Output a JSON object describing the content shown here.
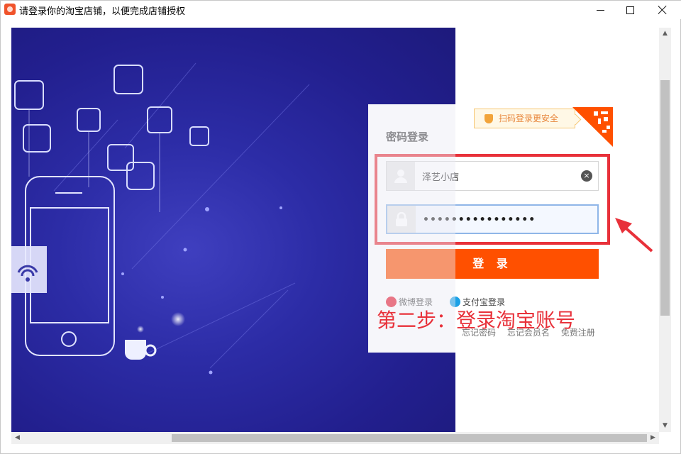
{
  "window": {
    "title": "请登录你的淘宝店铺，以便完成店铺授权",
    "controls": {
      "minimize": "minimize",
      "maximize": "maximize",
      "close": "close"
    }
  },
  "login": {
    "title": "密码登录",
    "qr_tip": "扫码登录更安全",
    "username": "泽艺小店",
    "password": "••••••••••••••••",
    "submit": "登 录",
    "alt": {
      "weibo": "微博登录",
      "alipay": "支付宝登录"
    },
    "links": {
      "forgot_password": "忘记密码",
      "forgot_username": "忘记会员名",
      "register": "免费注册"
    }
  },
  "annotation": {
    "step": "第二步：登录淘宝账号",
    "color": "#e8313a"
  },
  "colors": {
    "accent": "#ff5000",
    "hero": "#2c2ca6"
  }
}
